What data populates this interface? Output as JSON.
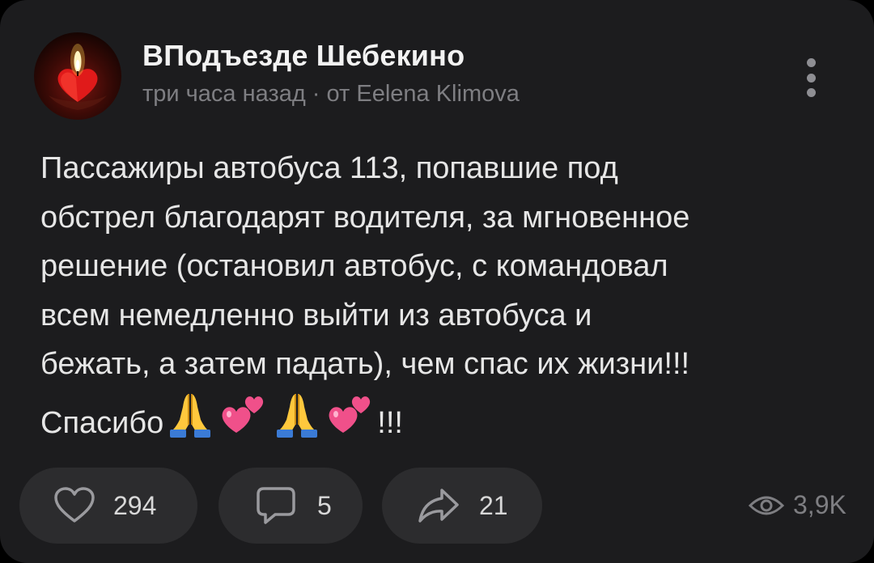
{
  "post": {
    "group_name": "ВПодъезде Шебекино",
    "meta": "три часа назад · от Eelena Klimova",
    "text_lines": [
      "Пассажиры автобуса 113, попавшие под",
      "обстрел благодарят водителя, за мгновенное",
      "решение (остановил автобус, с командовал",
      "всем немедленно выйти из автобуса и",
      "бежать, а затем падать), чем спас их жизни!!!"
    ],
    "last_line_text": "Спасибо",
    "last_line_suffix": "!!!",
    "emojis": [
      "folded-hands-icon",
      "two-hearts-icon",
      "folded-hands-icon",
      "two-hearts-icon"
    ]
  },
  "actions": {
    "likes": "294",
    "comments": "5",
    "shares": "21",
    "views": "3,9K"
  },
  "colors": {
    "card_bg": "#1c1c1e",
    "pill_bg": "#2c2c2e",
    "title": "#f2f2f2",
    "muted": "#7e7e82"
  }
}
